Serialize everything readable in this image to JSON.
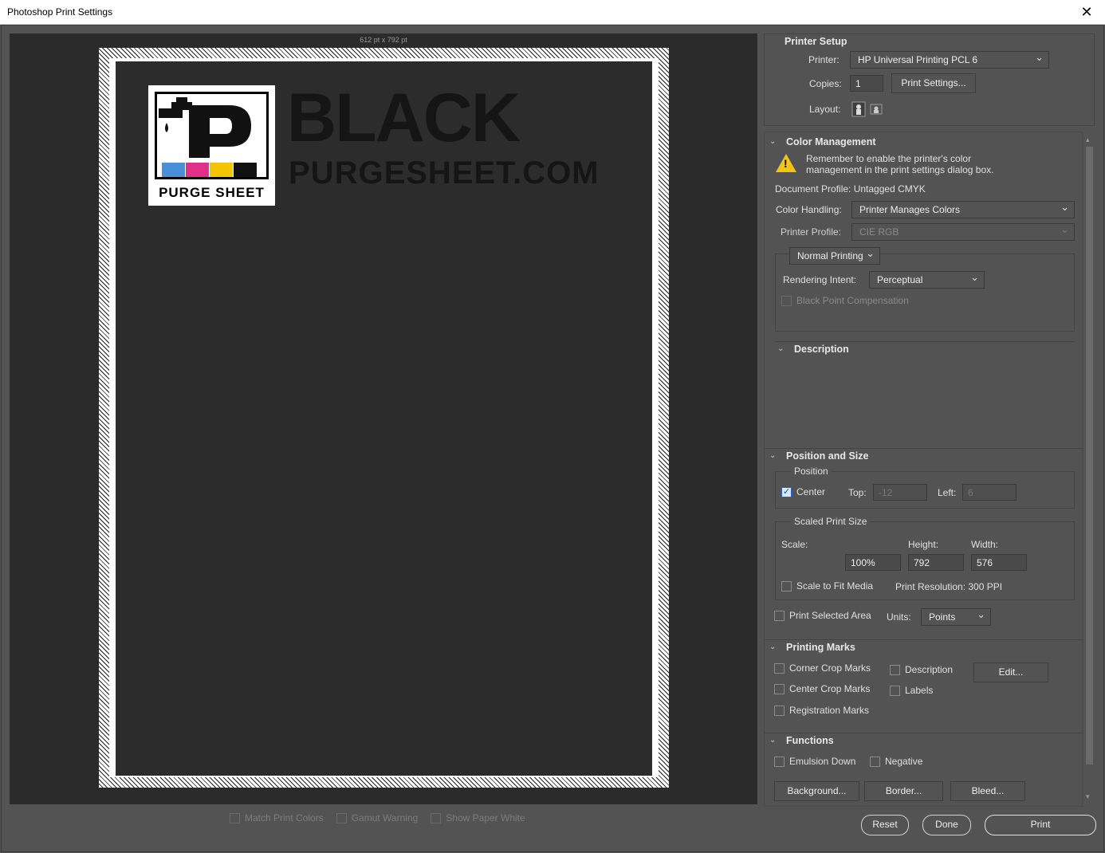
{
  "window": {
    "title": "Photoshop Print Settings",
    "close_glyph": "✕"
  },
  "preview": {
    "page_size": "612 pt x 792 pt",
    "logo_caption": "PURGE SHEET",
    "brand_big": "BLACK",
    "brand_small": "PURGESHEET.COM",
    "options": [
      "Match Print Colors",
      "Gamut Warning",
      "Show Paper White"
    ]
  },
  "printer_setup": {
    "title": "Printer Setup",
    "printer_label": "Printer:",
    "printer_value": "HP Universal Printing PCL 6",
    "copies_label": "Copies:",
    "copies_value": "1",
    "print_settings_button": "Print Settings...",
    "layout_label": "Layout:"
  },
  "color_management": {
    "title": "Color Management",
    "warning_line1": "Remember to enable the printer's color",
    "warning_line2": "management in the print settings dialog box.",
    "document_profile": "Document Profile: Untagged CMYK",
    "color_handling_label": "Color Handling:",
    "color_handling_value": "Printer Manages Colors",
    "printer_profile_label": "Printer Profile:",
    "printer_profile_value": "CIE RGB",
    "printing_mode": "Normal Printing",
    "rendering_intent_label": "Rendering Intent:",
    "rendering_intent_value": "Perceptual",
    "black_point": "Black Point Compensation"
  },
  "description": {
    "title": "Description"
  },
  "position_size": {
    "title": "Position and Size",
    "position_group": "Position",
    "center_label": "Center",
    "top_label": "Top:",
    "top_value": "-12",
    "left_label": "Left:",
    "left_value": "6",
    "scaled_group": "Scaled Print Size",
    "scale_label": "Scale:",
    "height_label": "Height:",
    "width_label": "Width:",
    "scale_value": "100%",
    "height_value": "792",
    "width_value": "576",
    "scale_to_fit": "Scale to Fit Media",
    "print_resolution": "Print Resolution: 300 PPI",
    "print_selected_area": "Print Selected Area",
    "units_label": "Units:",
    "units_value": "Points"
  },
  "printing_marks": {
    "title": "Printing Marks",
    "corner_crop": "Corner Crop Marks",
    "center_crop": "Center Crop Marks",
    "registration": "Registration Marks",
    "description": "Description",
    "labels": "Labels",
    "edit_button": "Edit..."
  },
  "functions": {
    "title": "Functions",
    "emulsion_down": "Emulsion Down",
    "negative": "Negative",
    "background_button": "Background...",
    "border_button": "Border...",
    "bleed_button": "Bleed..."
  },
  "footer": {
    "reset": "Reset",
    "done": "Done",
    "print": "Print"
  },
  "colors": {
    "accent_warning": "#f0c419",
    "logo_blue": "#4a90d9",
    "logo_magenta": "#e0308a",
    "logo_yellow": "#f5c400",
    "logo_black": "#111111"
  }
}
